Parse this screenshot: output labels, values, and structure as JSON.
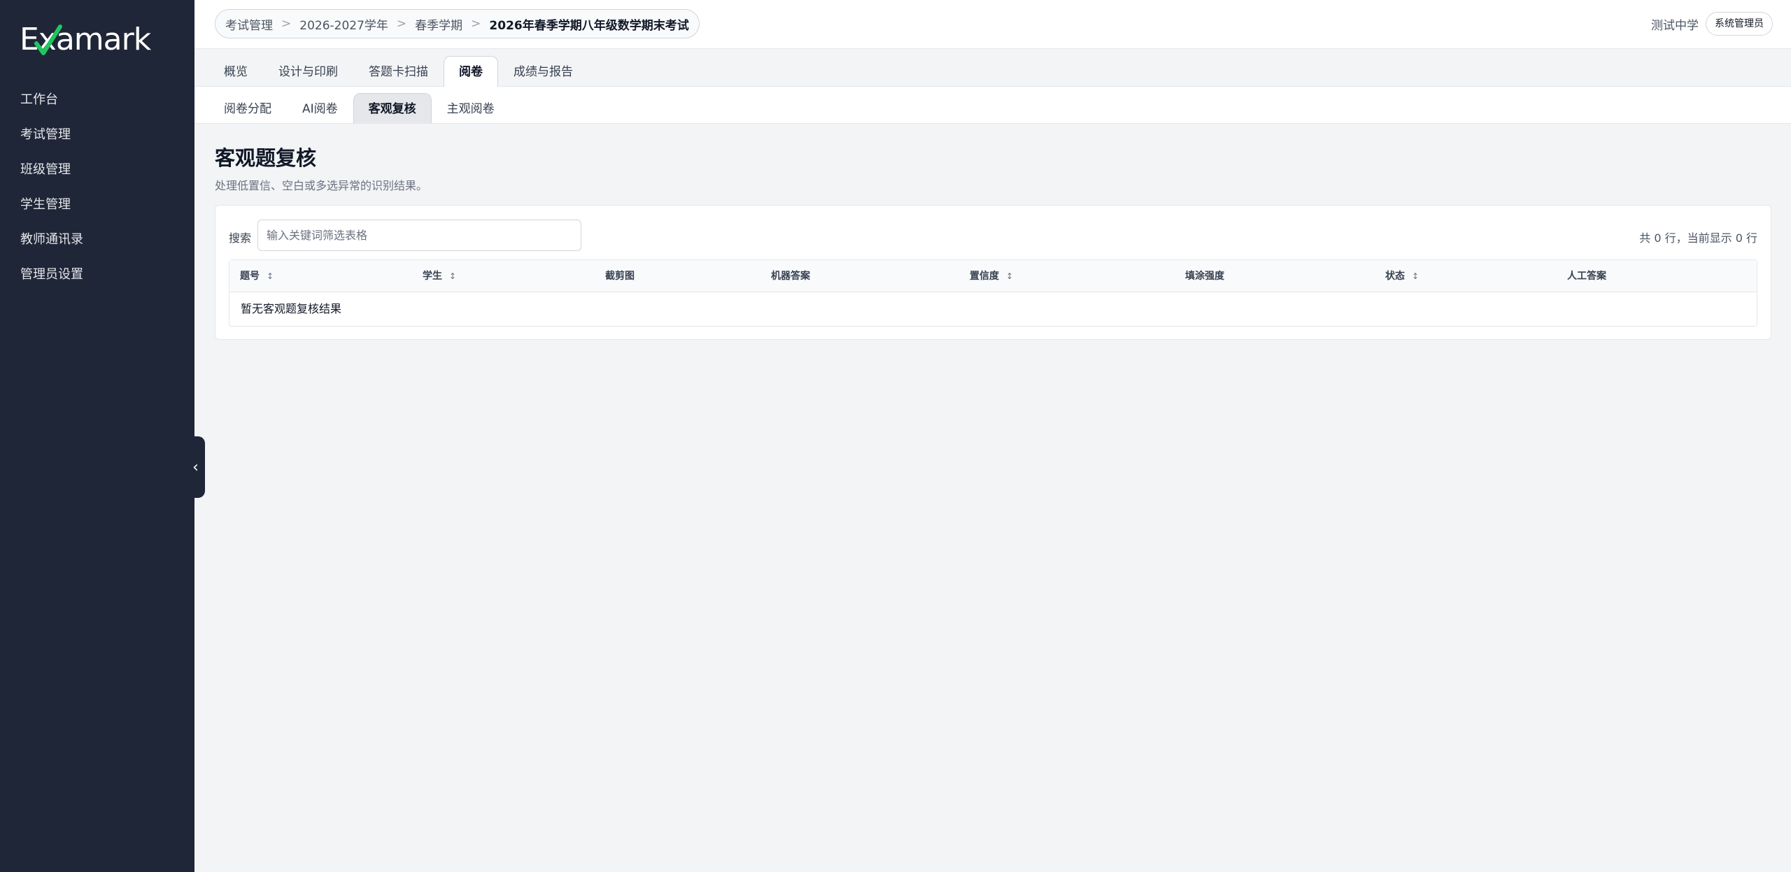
{
  "app": {
    "logo_text": "Examark",
    "collapse_icon": "‹"
  },
  "sidebar": {
    "items": [
      {
        "label": "工作台"
      },
      {
        "label": "考试管理"
      },
      {
        "label": "班级管理"
      },
      {
        "label": "学生管理"
      },
      {
        "label": "教师通讯录"
      },
      {
        "label": "管理员设置"
      }
    ]
  },
  "breadcrumb": {
    "items": [
      "考试管理",
      "2026-2027学年",
      "春季学期",
      "2026年春季学期八年级数学期末考试"
    ],
    "separator": ">"
  },
  "user": {
    "school": "测试中学",
    "role": "系统管理员"
  },
  "tabs": [
    {
      "label": "概览"
    },
    {
      "label": "设计与印刷"
    },
    {
      "label": "答题卡扫描"
    },
    {
      "label": "阅卷",
      "active": true
    },
    {
      "label": "成绩与报告"
    }
  ],
  "subtabs": [
    {
      "label": "阅卷分配"
    },
    {
      "label": "AI阅卷"
    },
    {
      "label": "客观复核",
      "active": true
    },
    {
      "label": "主观阅卷"
    }
  ],
  "page": {
    "title": "客观题复核",
    "description": "处理低置信、空白或多选异常的识别结果。"
  },
  "search": {
    "label": "搜索",
    "value": "",
    "placeholder": "输入关键词筛选表格"
  },
  "table": {
    "row_count_text": "共 0 行，当前显示 0 行",
    "columns": [
      {
        "label": "题号",
        "sortable": true
      },
      {
        "label": "学生",
        "sortable": true
      },
      {
        "label": "截剪图",
        "sortable": false
      },
      {
        "label": "机器答案",
        "sortable": false
      },
      {
        "label": "置信度",
        "sortable": true
      },
      {
        "label": "填涂强度",
        "sortable": false
      },
      {
        "label": "状态",
        "sortable": true
      },
      {
        "label": "人工答案",
        "sortable": false
      }
    ],
    "sort_icon": "↕",
    "empty_text": "暂无客观题复核结果"
  },
  "colors": {
    "sidebar_bg": "#1f2637",
    "page_bg": "#f3f4f6",
    "logo_check": "#22c55e"
  }
}
